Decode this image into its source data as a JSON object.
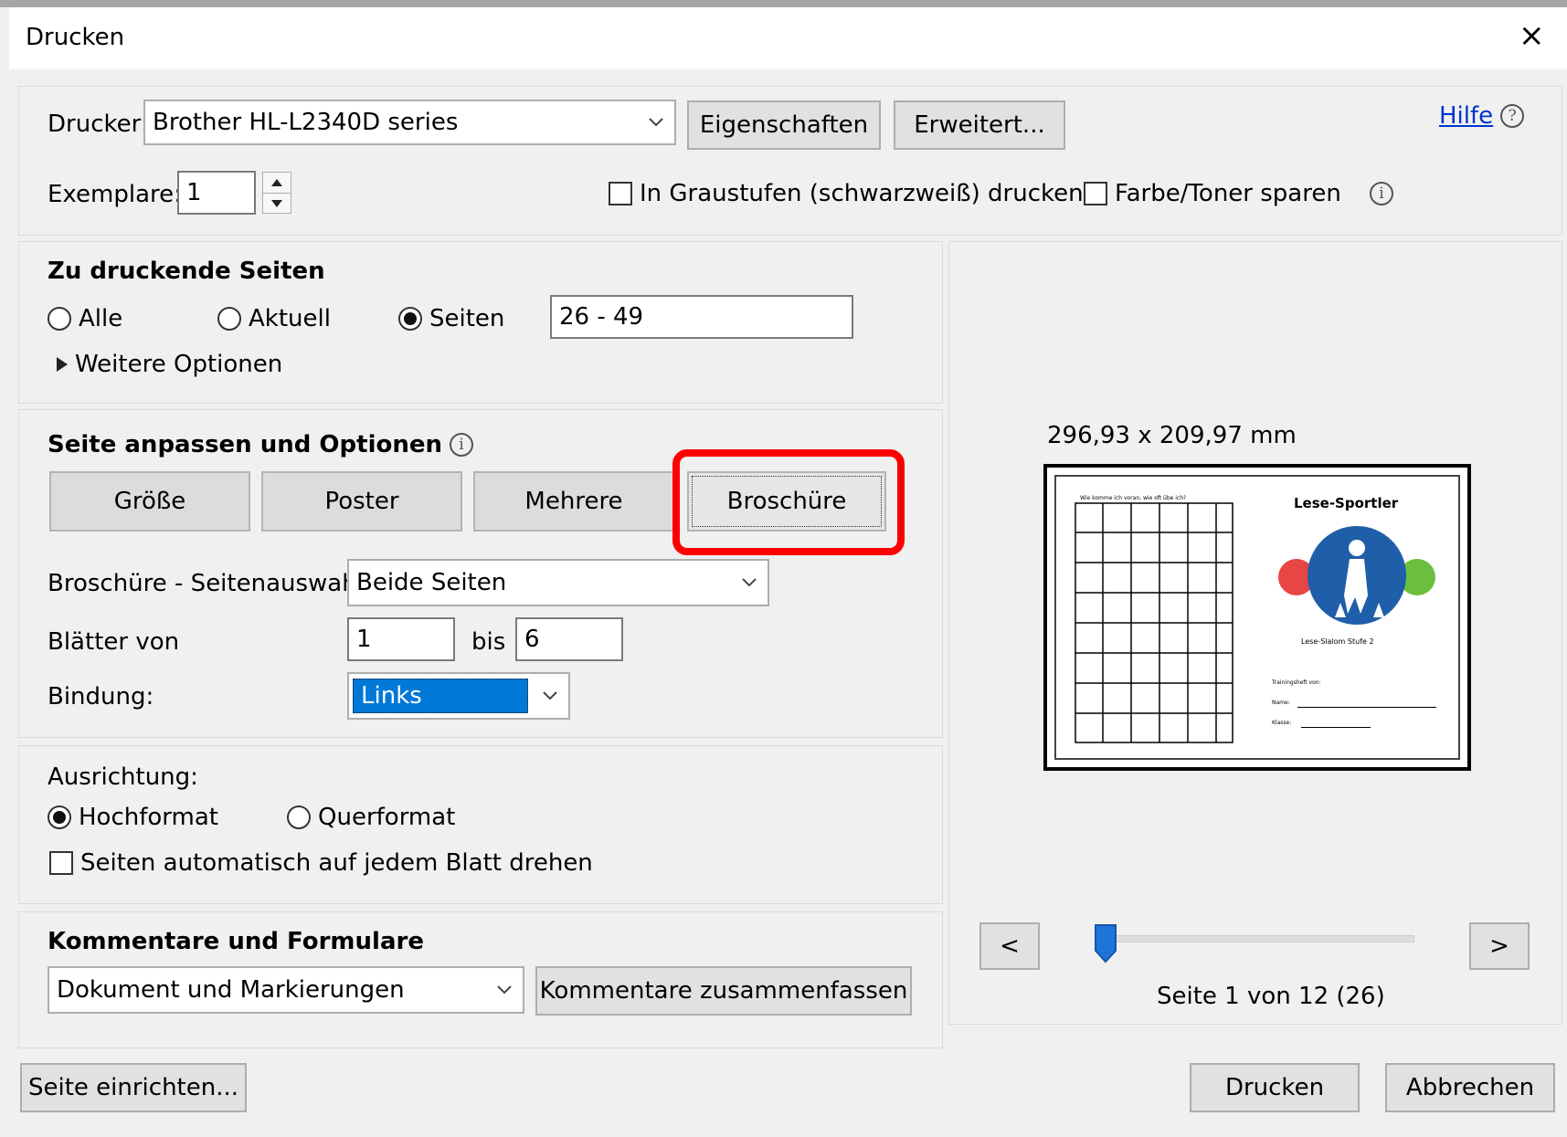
{
  "window": {
    "title": "Drucken",
    "close_symbol": "×"
  },
  "printer": {
    "label": "Drucker:",
    "selected": "Brother HL-L2340D series",
    "properties_button": "Eigenschaften",
    "advanced_button": "Erweitert...",
    "help_link": "Hilfe",
    "copies_label": "Exemplare:",
    "copies_value": "1",
    "grayscale_label": "In Graustufen (schwarzweiß) drucken",
    "grayscale_checked": false,
    "save_toner_label": "Farbe/Toner sparen",
    "save_toner_checked": false
  },
  "pages_section": {
    "heading": "Zu druckende Seiten",
    "options": [
      "Alle",
      "Aktuell",
      "Seiten"
    ],
    "selected": "Seiten",
    "range_value": "26 - 49",
    "more_options": "Weitere Optionen"
  },
  "sizing_section": {
    "heading": "Seite anpassen und Optionen",
    "tabs": [
      "Größe",
      "Poster",
      "Mehrere",
      "Broschüre"
    ],
    "active_tab": "Broschüre",
    "highlight_color": "#ff0000",
    "booklet_subset_label": "Broschüre - Seitenauswahl:",
    "booklet_subset_value": "Beide Seiten",
    "sheets_from_label": "Blätter von",
    "sheets_from_value": "1",
    "sheets_to_label": "bis",
    "sheets_to_value": "6",
    "binding_label": "Bindung:",
    "binding_value": "Links"
  },
  "orientation_section": {
    "heading": "Ausrichtung:",
    "options": [
      "Hochformat",
      "Querformat"
    ],
    "selected": "Hochformat",
    "auto_rotate_label": "Seiten automatisch auf jedem Blatt drehen",
    "auto_rotate_checked": false
  },
  "comments_section": {
    "heading": "Kommentare und Formulare",
    "selected": "Dokument und Markierungen",
    "summarize_button": "Kommentare zusammenfassen"
  },
  "preview": {
    "page_size": "296,93 x 209,97 mm",
    "prev_button": "<",
    "next_button": ">",
    "page_info": "Seite 1 von 12 (26)",
    "slider_position": 0.0,
    "thumb_color": "#1e74d8",
    "doc_title": "Lese-Sportler",
    "doc_subtitle": "Lese-Slalom Stufe 2",
    "doc_header": "Wie komme ich voran, wie oft übe ich?",
    "doc_field_1": "Trainingsheft von:",
    "doc_field_2": "Name:",
    "doc_field_3": "Klasse:"
  },
  "footer": {
    "page_setup_button": "Seite einrichten...",
    "print_button": "Drucken",
    "cancel_button": "Abbrechen"
  }
}
